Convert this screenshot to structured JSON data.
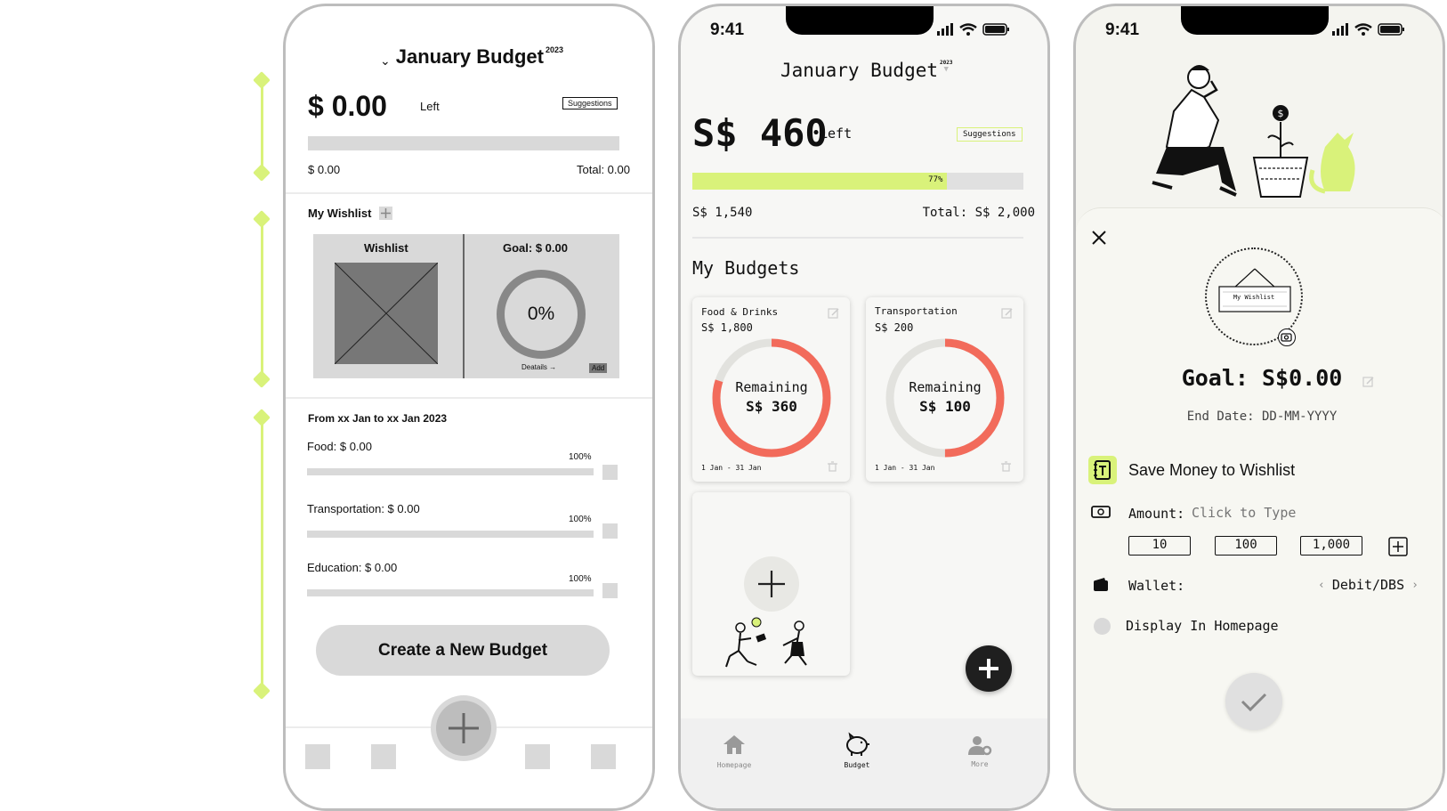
{
  "phone1": {
    "month_prefix": "⌄",
    "title": "January Budget",
    "year": "2023",
    "amount": "$ 0.00",
    "left_label": "Left",
    "suggestions": "Suggestions",
    "spent": "$ 0.00",
    "total": "Total: 0.00",
    "wishlist_heading": "My Wishlist",
    "wishlist_box_title": "Wishlist",
    "goal": "Goal: $ 0.00",
    "goal_percent": "0%",
    "details": "Deatails →",
    "add": "Add",
    "period": "From xx Jan to xx Jan 2023",
    "categories": [
      {
        "label": "Food: $ 0.00",
        "percent": "100%"
      },
      {
        "label": "Transportation: $ 0.00",
        "percent": "100%"
      },
      {
        "label": "Education: $ 0.00",
        "percent": "100%"
      }
    ],
    "create_button": "Create a New Budget"
  },
  "phone2": {
    "time": "9:41",
    "title": "January Budget",
    "year": "2023",
    "amount": "S$ 460",
    "left_label": "Left",
    "suggestions": "Suggestions",
    "progress_label": "77%",
    "progress": 0.77,
    "spent": "S$ 1,540",
    "total": "Total: S$ 2,000",
    "section": "My Budgets",
    "budgets": [
      {
        "category": "Food & Drinks",
        "amount": "S$ 1,800",
        "remaining_label": "Remaining",
        "remaining": "S$ 360",
        "range": "1 Jan - 31 Jan",
        "ring_fraction": 0.8
      },
      {
        "category": "Transportation",
        "amount": "S$ 200",
        "remaining_label": "Remaining",
        "remaining": "S$ 100",
        "range": "1 Jan - 31 Jan",
        "ring_fraction": 0.5
      }
    ],
    "nav": [
      {
        "label": "Homepage",
        "icon": "home-icon"
      },
      {
        "label": "Budget",
        "icon": "piggy-bank-icon"
      },
      {
        "label": "More",
        "icon": "user-settings-icon"
      }
    ],
    "colors": {
      "accent": "#d9f27a",
      "ring": "#f26b5b",
      "ring_track": "#e2e2de"
    }
  },
  "phone3": {
    "time": "9:41",
    "sign_text": "My Wishlist",
    "goal": "Goal: S$0.00",
    "end_date": "End Date: DD-MM-YYYY",
    "save_title": "Save Money to Wishlist",
    "amount_label": "Amount:",
    "amount_placeholder": "Click to Type",
    "presets": [
      "10",
      "100",
      "1,000"
    ],
    "wallet_label": "Wallet:",
    "wallet_value": "Debit/DBS",
    "display_label": "Display In Homepage"
  }
}
